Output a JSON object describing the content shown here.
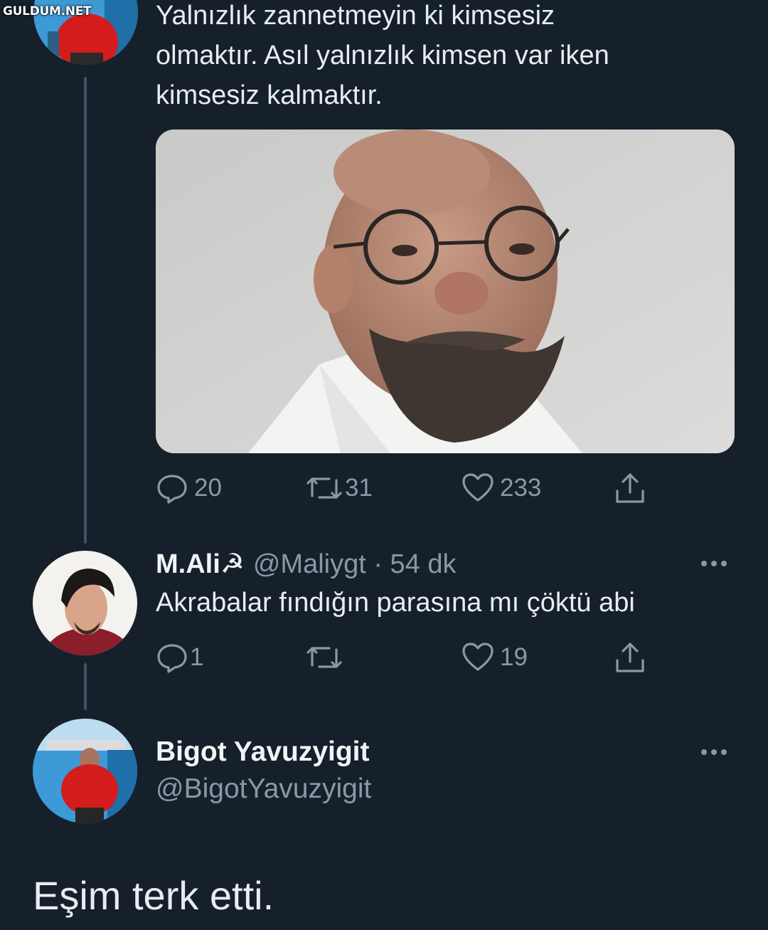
{
  "watermark": "GULDUM.NET",
  "original_tweet": {
    "lines": [
      "Yalnızlık zannetmeyin ki kimsesiz",
      "olmaktır. Asıl yalnızlık kimsen var iken",
      "kimsesiz kalmaktır."
    ],
    "media_icon": "portrait-photo-man-glasses-beard",
    "actions": {
      "replies": "20",
      "retweets": "31",
      "likes": "233"
    }
  },
  "reply": {
    "name": "M.Ali☭",
    "handle": "@Maliygt · 54 dk",
    "text": "Akrabalar fındığın parasına mı çöktü abi",
    "actions": {
      "replies": "1",
      "retweets": "",
      "likes": "19"
    }
  },
  "author_reply": {
    "name": "Bigot Yavuzyigit",
    "handle": "@BigotYavuzyigit",
    "text": "Eşim terk etti."
  },
  "colors": {
    "background": "#15202b",
    "secondary_text": "#8899a6",
    "primary_text": "#e8edf1",
    "thread_line": "#3d5466"
  }
}
